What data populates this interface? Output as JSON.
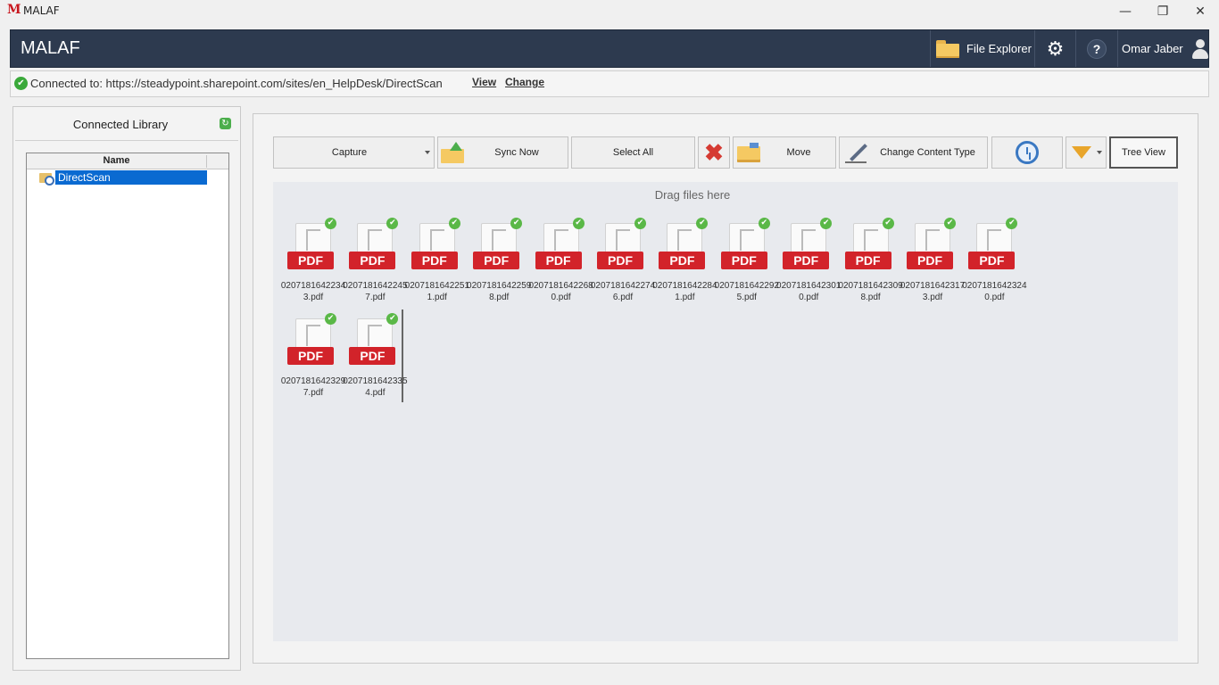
{
  "window": {
    "logo_letter": "M",
    "title": "MALAF",
    "minimize_glyph": "—",
    "restore_glyph": "❐",
    "close_glyph": "✕"
  },
  "header": {
    "brand": "MALAF",
    "file_explorer_label": "File Explorer",
    "settings_glyph": "⚙",
    "help_glyph": "?",
    "user_name": "Omar Jaber"
  },
  "connection": {
    "status_glyph": "✔",
    "text": "Connected to: https://steadypoint.sharepoint.com/sites/en_HelpDesk/DirectScan",
    "view_label": "View",
    "change_label": "Change"
  },
  "library": {
    "title": "Connected Library",
    "refresh_glyph": "↻",
    "column_header": "Name",
    "items": [
      {
        "label": "DirectScan",
        "selected": true
      }
    ]
  },
  "toolbar": {
    "capture_label": "Capture",
    "sync_label": "Sync Now",
    "select_all_label": "Select All",
    "delete_glyph": "✖",
    "move_label": "Move",
    "change_content_type_label": "Change Content Type",
    "tree_view_label": "Tree View"
  },
  "dropzone": {
    "hint": "Drag files here"
  },
  "files": [
    {
      "badge": "PDF",
      "name": "02071816422343.pdf"
    },
    {
      "badge": "PDF",
      "name": "02071816422457.pdf"
    },
    {
      "badge": "PDF",
      "name": "02071816422511.pdf"
    },
    {
      "badge": "PDF",
      "name": "02071816422598.pdf"
    },
    {
      "badge": "PDF",
      "name": "02071816422680.pdf"
    },
    {
      "badge": "PDF",
      "name": "02071816422746.pdf"
    },
    {
      "badge": "PDF",
      "name": "02071816422841.pdf"
    },
    {
      "badge": "PDF",
      "name": "02071816422925.pdf"
    },
    {
      "badge": "PDF",
      "name": "02071816423010.pdf"
    },
    {
      "badge": "PDF",
      "name": "02071816423098.pdf"
    },
    {
      "badge": "PDF",
      "name": "02071816423173.pdf"
    },
    {
      "badge": "PDF",
      "name": "02071816423240.pdf"
    },
    {
      "badge": "PDF",
      "name": "02071816423297.pdf"
    },
    {
      "badge": "PDF",
      "name": "02071816423354.pdf"
    }
  ],
  "colors": {
    "header_bg": "#2d3a4f",
    "pdf_red": "#d2232a",
    "selection_blue": "#0a6ad1",
    "ok_green": "#5ab847"
  }
}
